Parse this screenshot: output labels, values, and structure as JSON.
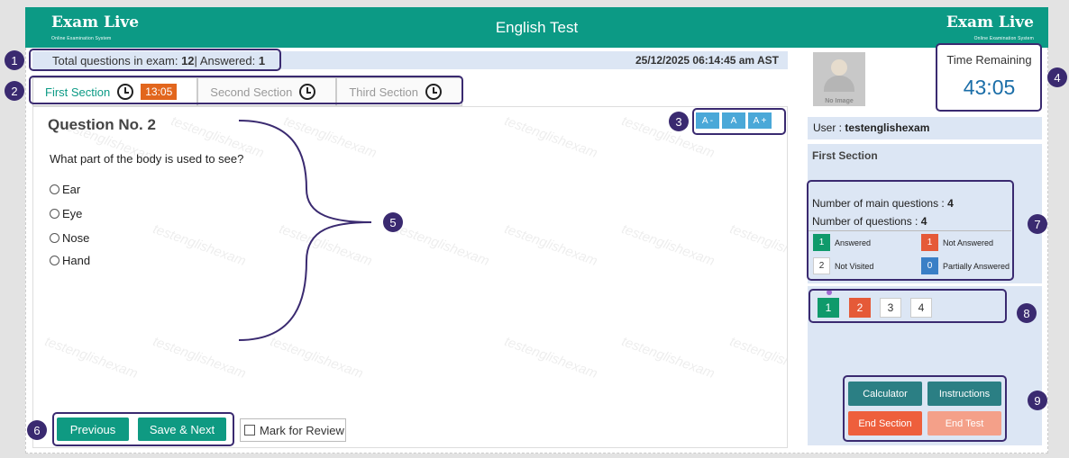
{
  "header": {
    "logo_left": "Exam Live",
    "logo_left_sub": "Online Examination System",
    "title": "English Test",
    "logo_right": "Exam Live",
    "logo_right_sub": "Online Examination System"
  },
  "info": {
    "total_label": "Total questions in exam: ",
    "total_value": "12",
    "answered_label": "| Answered: ",
    "answered_value": "1",
    "datetime": "25/12/2025 06:14:45 am AST"
  },
  "tabs": [
    {
      "label": "First Section",
      "timer": "13:05",
      "active": true
    },
    {
      "label": "Second Section",
      "active": false
    },
    {
      "label": "Third Section",
      "active": false
    }
  ],
  "question": {
    "title": "Question No. 2",
    "text": "What part of the body is used to see?",
    "options": [
      "Ear",
      "Eye",
      "Nose",
      "Hand"
    ],
    "font_buttons": [
      "A -",
      "A",
      "A +"
    ],
    "watermark": "testenglishexam"
  },
  "actions": {
    "previous": "Previous",
    "save_next": "Save & Next",
    "mark_review": "Mark for Review"
  },
  "sidebar": {
    "no_image": "No Image",
    "time_label": "Time Remaining",
    "time_value": "43:05",
    "user_label": "User : ",
    "user_name": "testenglishexam",
    "section_title": "First Section",
    "main_questions_label": "Number of main questions : ",
    "main_questions_value": "4",
    "questions_label": "Number of questions : ",
    "questions_value": "4",
    "legend": [
      {
        "count": "1",
        "label": "Answered",
        "color": "#0f9a6b"
      },
      {
        "count": "1",
        "label": "Not Answered",
        "color": "#e55a38"
      },
      {
        "count": "2",
        "label": "Not Visited",
        "color": "#ffffff"
      },
      {
        "count": "0",
        "label": "Partially Answered",
        "color": "#3a7fc6"
      }
    ],
    "palette": [
      "1",
      "2",
      "3",
      "4"
    ],
    "buttons": {
      "calculator": "Calculator",
      "instructions": "Instructions",
      "end_section": "End Section",
      "end_test": "End Test"
    }
  },
  "callouts": [
    "1",
    "2",
    "3",
    "4",
    "5",
    "6",
    "7",
    "8",
    "9"
  ]
}
